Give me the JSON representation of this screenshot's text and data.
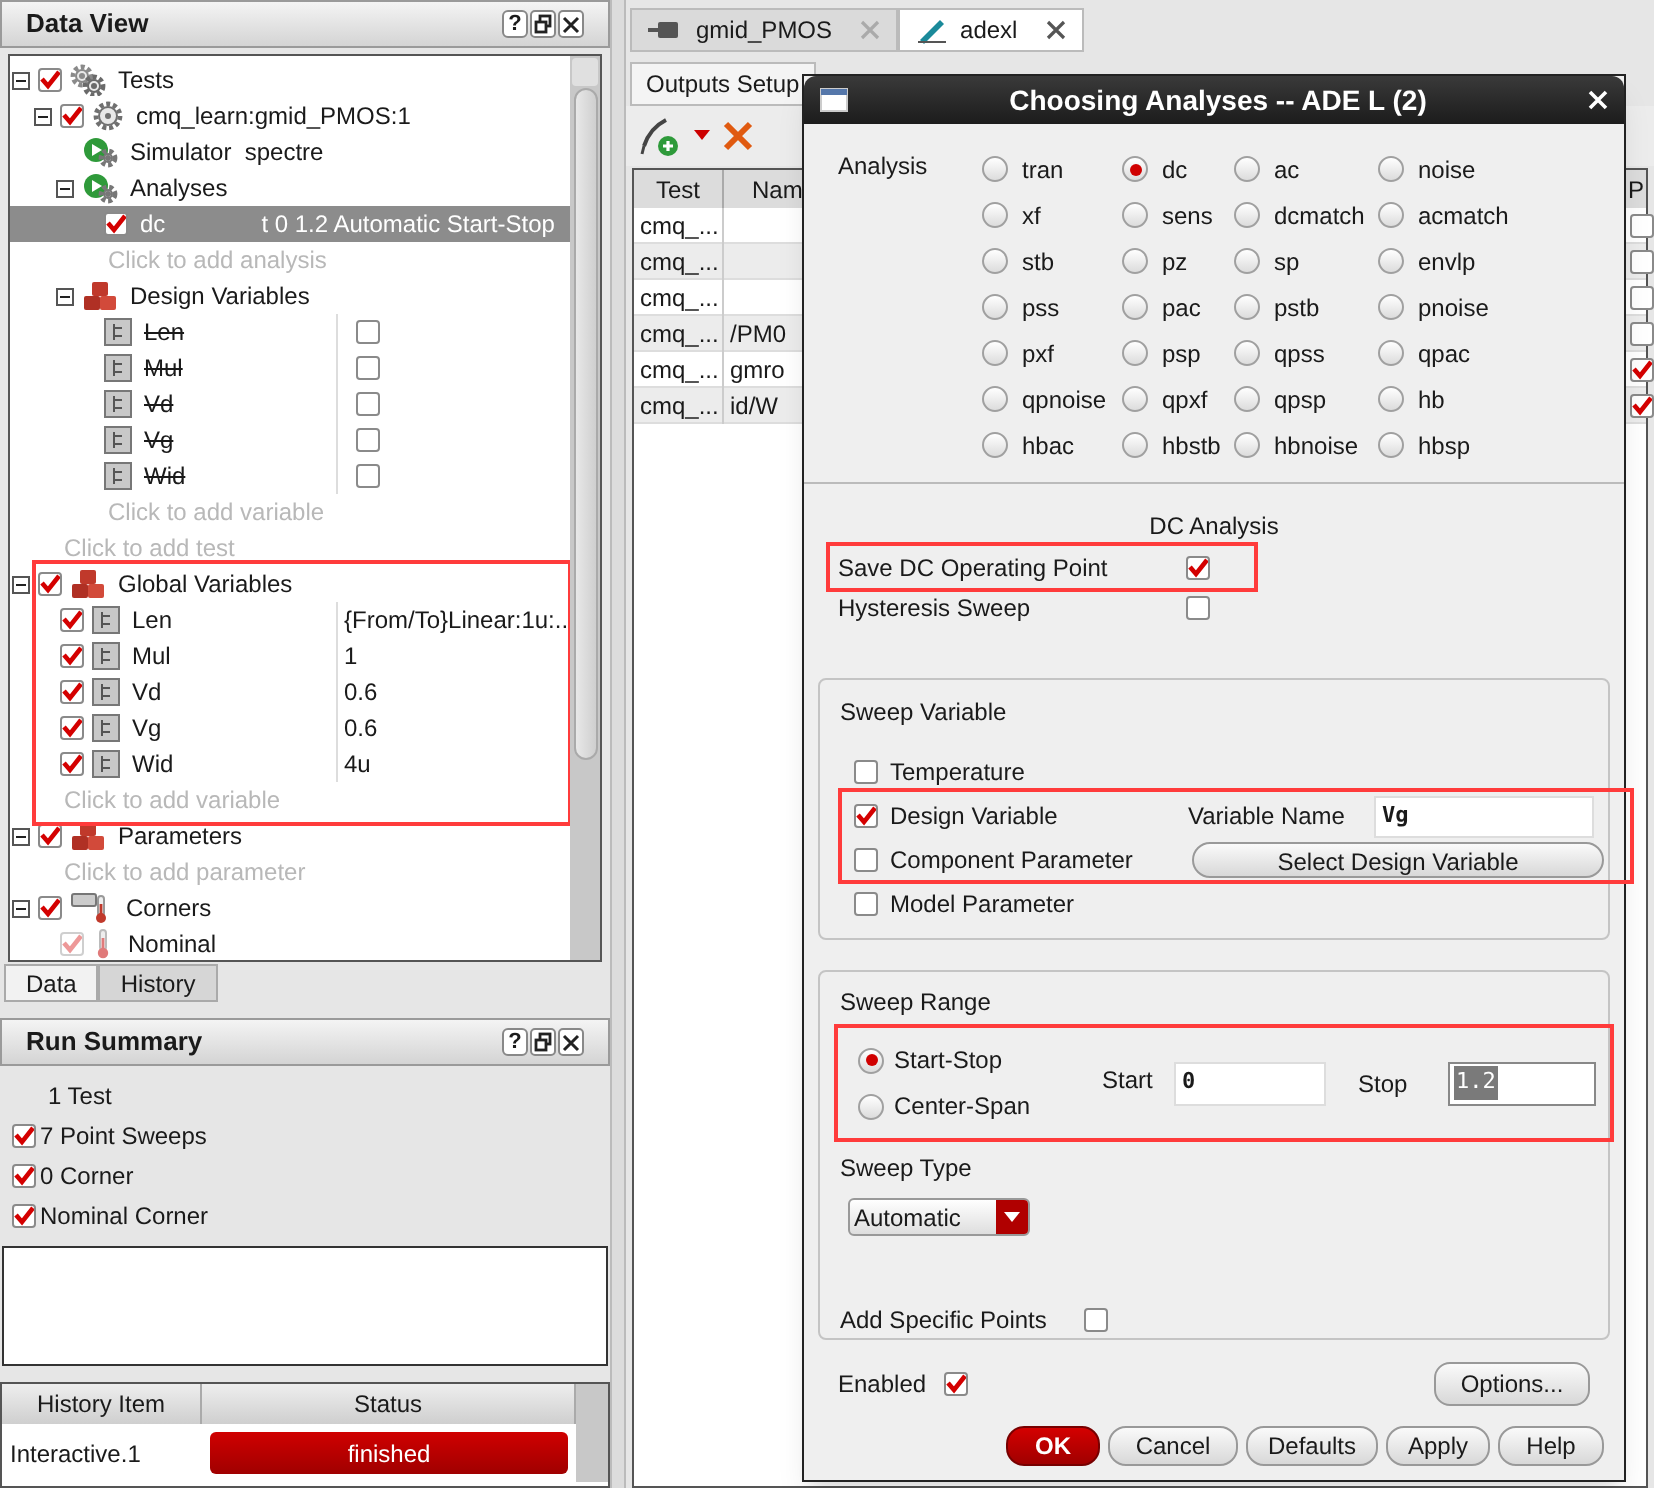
{
  "data_view": {
    "title": "Data View",
    "help": "?",
    "tree": [
      {
        "label": "Tests",
        "kind": "tests",
        "checked": true,
        "expanded": true,
        "children": [
          {
            "label": "cmq_learn:gmid_PMOS:1",
            "kind": "test",
            "checked": true,
            "expanded": true,
            "children": [
              {
                "label": "Simulator  spectre",
                "kind": "simulator"
              },
              {
                "label": "Analyses",
                "kind": "analyses",
                "expanded": true,
                "children": [
                  {
                    "label": "dc",
                    "kind": "analysis",
                    "checked": true,
                    "selected": true,
                    "value": "t 0 1.2 Automatic Start-Stop"
                  },
                  {
                    "label": "Click to add analysis",
                    "kind": "hint",
                    "selected": false
                  }
                ]
              },
              {
                "label": "Design Variables",
                "kind": "variables",
                "expanded": true,
                "children": [
                  {
                    "label": "Len",
                    "kind": "design_variable",
                    "struck": true,
                    "checked": false
                  },
                  {
                    "label": "Mul",
                    "kind": "design_variable",
                    "struck": true,
                    "checked": false
                  },
                  {
                    "label": "Vd",
                    "kind": "design_variable",
                    "struck": true,
                    "checked": false
                  },
                  {
                    "label": "Vg",
                    "kind": "design_variable",
                    "struck": true,
                    "checked": false
                  },
                  {
                    "label": "Wid",
                    "kind": "design_variable",
                    "struck": true,
                    "checked": false
                  },
                  {
                    "label": "Click to add variable",
                    "kind": "hint"
                  }
                ]
              }
            ]
          },
          {
            "label": "Click to add test",
            "kind": "hint"
          }
        ]
      },
      {
        "label": "Global Variables",
        "kind": "variables",
        "checked": true,
        "expanded": true,
        "highlighted": true,
        "children": [
          {
            "label": "Len",
            "kind": "global_variable",
            "checked": true,
            "value": "{From/To}Linear:1u:..."
          },
          {
            "label": "Mul",
            "kind": "global_variable",
            "checked": true,
            "value": "1"
          },
          {
            "label": "Vd",
            "kind": "global_variable",
            "checked": true,
            "value": "0.6"
          },
          {
            "label": "Vg",
            "kind": "global_variable",
            "checked": true,
            "value": "0.6"
          },
          {
            "label": "Wid",
            "kind": "global_variable",
            "checked": true,
            "value": "4u"
          },
          {
            "label": "Click to add variable",
            "kind": "hint"
          }
        ]
      },
      {
        "label": "Parameters",
        "kind": "variables",
        "checked": true,
        "expanded": true,
        "children": [
          {
            "label": "Click to add parameter",
            "kind": "hint"
          }
        ]
      },
      {
        "label": "Corners",
        "kind": "corners",
        "checked": true,
        "expanded": true,
        "children": [
          {
            "label": "Nominal",
            "kind": "corner",
            "checked": true,
            "disabled": true
          }
        ]
      }
    ]
  },
  "bottom_tabs": [
    {
      "label": "Data",
      "selected": true
    },
    {
      "label": "History",
      "selected": false
    }
  ],
  "run_summary": {
    "title": "Run Summary",
    "help": "?",
    "items": [
      {
        "label": "1 Test",
        "kind": "plain"
      },
      {
        "label": "7 Point Sweeps",
        "kind": "check",
        "checked": true
      },
      {
        "label": "0 Corner",
        "kind": "check",
        "checked": true
      },
      {
        "label": "Nominal Corner",
        "kind": "check",
        "checked": true
      }
    ]
  },
  "history": {
    "columns": [
      "History Item",
      "Status"
    ],
    "rows": [
      {
        "item": "Interactive.1",
        "status": "finished"
      }
    ]
  },
  "editor_tabs": [
    {
      "label": "gmid_PMOS",
      "kind": "schematic",
      "selected": false
    },
    {
      "label": "adexl",
      "kind": "adexl",
      "selected": true
    }
  ],
  "setup_tabs": [
    {
      "label": "Outputs Setup",
      "selected": true
    }
  ],
  "outputs_table": {
    "columns": [
      "Test",
      "Nam",
      "P"
    ],
    "rows": [
      {
        "test": "cmq_...",
        "checked": false
      },
      {
        "test": "cmq_...",
        "checked": false
      },
      {
        "test": "cmq_...",
        "checked": false
      },
      {
        "test": "cmq_...",
        "name": "/PM0",
        "checked": false
      },
      {
        "test": "cmq_...",
        "name": "gmro",
        "checked": true
      },
      {
        "test": "cmq_...",
        "name": "id/W",
        "checked": true
      }
    ]
  },
  "dialog": {
    "title": "Choosing Analyses -- ADE L (2)",
    "analysis_label": "Analysis",
    "analyses": [
      {
        "label": "tran",
        "selected": false
      },
      {
        "label": "dc",
        "selected": true
      },
      {
        "label": "ac",
        "selected": false
      },
      {
        "label": "noise",
        "selected": false
      },
      {
        "label": "xf",
        "selected": false
      },
      {
        "label": "sens",
        "selected": false
      },
      {
        "label": "dcmatch",
        "selected": false
      },
      {
        "label": "acmatch",
        "selected": false
      },
      {
        "label": "stb",
        "selected": false
      },
      {
        "label": "pz",
        "selected": false
      },
      {
        "label": "sp",
        "selected": false
      },
      {
        "label": "envlp",
        "selected": false
      },
      {
        "label": "pss",
        "selected": false
      },
      {
        "label": "pac",
        "selected": false
      },
      {
        "label": "pstb",
        "selected": false
      },
      {
        "label": "pnoise",
        "selected": false
      },
      {
        "label": "pxf",
        "selected": false
      },
      {
        "label": "psp",
        "selected": false
      },
      {
        "label": "qpss",
        "selected": false
      },
      {
        "label": "qpac",
        "selected": false
      },
      {
        "label": "qpnoise",
        "selected": false
      },
      {
        "label": "qpxf",
        "selected": false
      },
      {
        "label": "qpsp",
        "selected": false
      },
      {
        "label": "hb",
        "selected": false
      },
      {
        "label": "hbac",
        "selected": false
      },
      {
        "label": "hbstb",
        "selected": false
      },
      {
        "label": "hbnoise",
        "selected": false
      },
      {
        "label": "hbsp",
        "selected": false
      }
    ],
    "section_title": "DC Analysis",
    "save_dc_op": {
      "label": "Save DC Operating Point",
      "checked": true,
      "highlighted": true
    },
    "hysteresis": {
      "label": "Hysteresis Sweep",
      "checked": false
    },
    "sweep_variable": {
      "title": "Sweep Variable",
      "highlighted": true,
      "options": [
        {
          "label": "Temperature",
          "checked": false
        },
        {
          "label": "Design Variable",
          "checked": true
        },
        {
          "label": "Component Parameter",
          "checked": false
        },
        {
          "label": "Model Parameter",
          "checked": false
        }
      ],
      "variable_name_label": "Variable Name",
      "variable_name": "Vg",
      "select_button": "Select Design Variable"
    },
    "sweep_range": {
      "title": "Sweep Range",
      "highlighted": true,
      "modes": [
        {
          "label": "Start-Stop",
          "selected": true
        },
        {
          "label": "Center-Span",
          "selected": false
        }
      ],
      "start_label": "Start",
      "start": "0",
      "stop_label": "Stop",
      "stop": "1.2"
    },
    "sweep_type": {
      "label": "Sweep Type",
      "value": "Automatic"
    },
    "add_specific_points": {
      "label": "Add Specific Points",
      "checked": false
    },
    "enabled": {
      "label": "Enabled",
      "checked": true
    },
    "options_button": "Options...",
    "buttons": [
      {
        "label": "OK",
        "kind": "primary"
      },
      {
        "label": "Cancel",
        "kind": "normal"
      },
      {
        "label": "Defaults",
        "kind": "normal"
      },
      {
        "label": "Apply",
        "kind": "normal"
      },
      {
        "label": "Help",
        "kind": "normal"
      }
    ]
  }
}
